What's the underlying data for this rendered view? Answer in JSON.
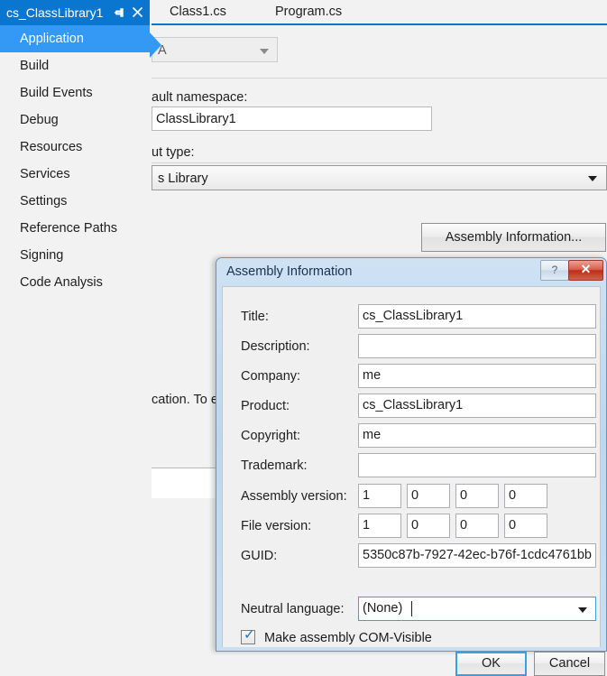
{
  "window": {
    "project_tab": {
      "label": "cs_ClassLibrary1",
      "pin_icon": "pin-icon",
      "close_icon": "close-icon"
    },
    "document_tabs": [
      {
        "label": "Class1.cs"
      },
      {
        "label": "Program.cs"
      }
    ]
  },
  "sidebar": {
    "items": [
      {
        "label": "Application",
        "selected": true
      },
      {
        "label": "Build",
        "selected": false
      },
      {
        "label": "Build Events",
        "selected": false
      },
      {
        "label": "Debug",
        "selected": false
      },
      {
        "label": "Resources",
        "selected": false
      },
      {
        "label": "Services",
        "selected": false
      },
      {
        "label": "Settings",
        "selected": false
      },
      {
        "label": "Reference Paths",
        "selected": false
      },
      {
        "label": "Signing",
        "selected": false
      },
      {
        "label": "Code Analysis",
        "selected": false
      }
    ]
  },
  "property_page": {
    "configuration_combo_value": "A",
    "namespace_label": "ault namespace:",
    "namespace_value": "ClassLibrary1",
    "output_type_label": "ut type:",
    "output_type_value": "s Library",
    "assembly_info_button": "Assembly Information...",
    "description_fragment": "cation. To e"
  },
  "dialog": {
    "title": "Assembly Information",
    "help_icon": "help-icon",
    "close_icon": "close-icon",
    "fields": [
      {
        "label": "Title:",
        "value": "cs_ClassLibrary1"
      },
      {
        "label": "Description:",
        "value": ""
      },
      {
        "label": "Company:",
        "value": "me"
      },
      {
        "label": "Product:",
        "value": "cs_ClassLibrary1"
      },
      {
        "label": "Copyright:",
        "value": "me"
      },
      {
        "label": "Trademark:",
        "value": ""
      }
    ],
    "assembly_version": {
      "label": "Assembly version:",
      "parts": [
        "1",
        "0",
        "0",
        "0"
      ]
    },
    "file_version": {
      "label": "File version:",
      "parts": [
        "1",
        "0",
        "0",
        "0"
      ]
    },
    "guid": {
      "label": "GUID:",
      "value": "5350c87b-7927-42ec-b76f-1cdc4761bb"
    },
    "neutral_language": {
      "label": "Neutral language:",
      "value": "(None)"
    },
    "com_visible": {
      "label": "Make assembly COM-Visible",
      "checked": true,
      "check_glyph": "✓"
    },
    "buttons": {
      "ok": "OK",
      "cancel": "Cancel"
    }
  },
  "colors": {
    "tab_blue": "#0b76cf",
    "selection_blue": "#3399f5",
    "focus_blue": "#3d9fe0",
    "close_red": "#bf2c18",
    "page_bg": "#f2f2f2",
    "dialog_bg": "#f0f0f0"
  }
}
